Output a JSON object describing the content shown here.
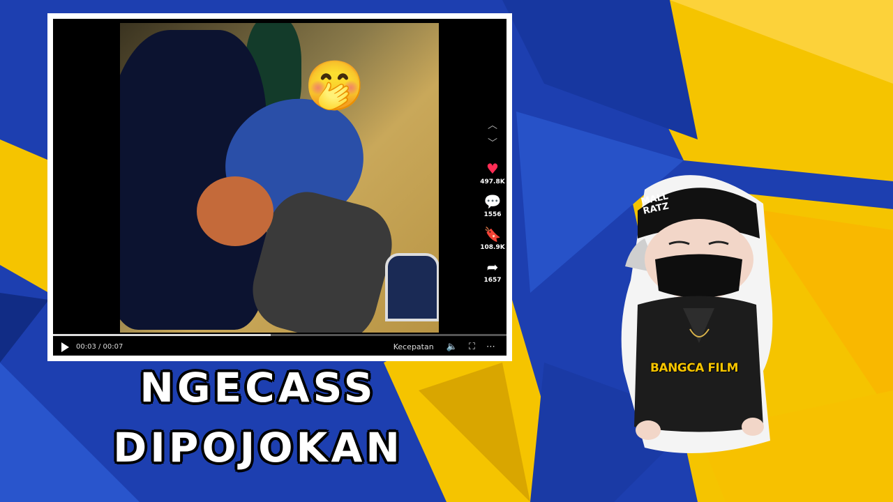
{
  "video": {
    "emoji": "🤭",
    "rail": {
      "likes": "497.8K",
      "comments": "1556",
      "saves": "108.9K",
      "shares": "1657"
    },
    "progress_fraction": 0.48,
    "time": "00:03 / 00:07",
    "speed_label": "Kecepatan",
    "icons": [
      "chevron-up-icon",
      "chevron-down-icon",
      "heart-icon",
      "comment-icon",
      "bookmark-icon",
      "share-icon",
      "play-icon",
      "volume-icon",
      "fullscreen-icon",
      "more-icon"
    ]
  },
  "title": {
    "line1": "NGECASS",
    "line2": "DIPOJOKAN"
  },
  "mascot": {
    "cap_text": "MALL RATZ",
    "brand": "BANGCA FILM"
  },
  "colors": {
    "bg_blue": "#1d3fb0",
    "bg_yellow": "#f5c400",
    "like_red": "#ff2d55",
    "brand_yellow": "#f6c400"
  }
}
